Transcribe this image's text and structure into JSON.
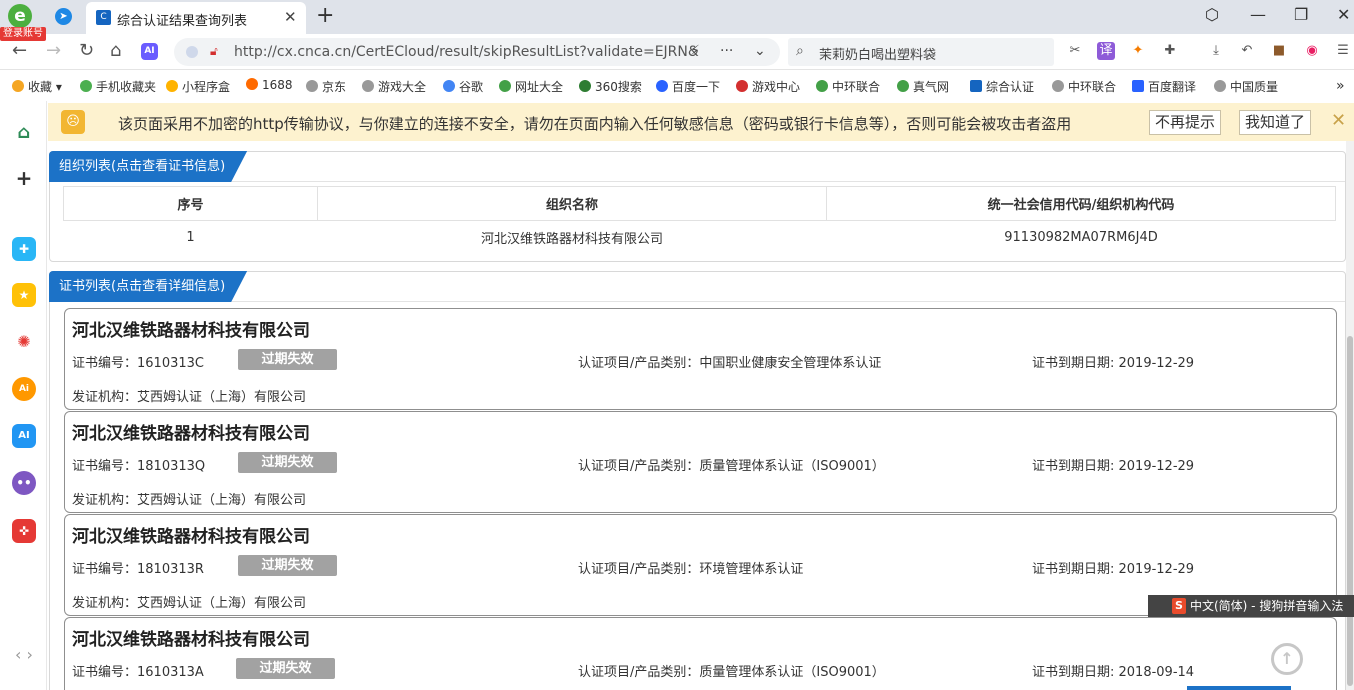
{
  "browser": {
    "login_badge": "登录账号",
    "tab_title": "综合认证结果查询列表",
    "url": "http://cx.cnca.cn/CertECloud/result/skipResultList?validate=EJRN&",
    "url_more": "···",
    "search_text": "茉莉奶白喝出塑料袋",
    "ai_label": "AI",
    "translate_label": "译"
  },
  "bookmarks": [
    {
      "label": "收藏",
      "color": "#f5a623"
    },
    {
      "label": "手机收藏夹",
      "color": "#4caf50"
    },
    {
      "label": "小程序盒",
      "color": "#ffb300"
    },
    {
      "label": "1688",
      "color": "#ff6a00"
    },
    {
      "label": "京东",
      "color": "#999999"
    },
    {
      "label": "游戏大全",
      "color": "#999999"
    },
    {
      "label": "谷歌",
      "color": "#4285f4"
    },
    {
      "label": "网址大全",
      "color": "#43a047"
    },
    {
      "label": "360搜索",
      "color": "#2e7d32"
    },
    {
      "label": "百度一下",
      "color": "#2962ff"
    },
    {
      "label": "游戏中心",
      "color": "#d32f2f"
    },
    {
      "label": "中环联合",
      "color": "#43a047"
    },
    {
      "label": "真气网",
      "color": "#43a047"
    },
    {
      "label": "综合认证",
      "color": "#1565c0"
    },
    {
      "label": "中环联合",
      "color": "#999999"
    },
    {
      "label": "百度翻译",
      "color": "#2962ff"
    },
    {
      "label": "中国质量",
      "color": "#999999"
    }
  ],
  "warning": {
    "text": "该页面采用不加密的http传输协议，与你建立的连接不安全，请勿在页面内输入任何敏感信息（密码或银行卡信息等），否则可能会被攻击者盗用",
    "btn_no_remind": "不再提示",
    "btn_ok": "我知道了"
  },
  "org_panel": {
    "title": "组织列表(点击查看证书信息)",
    "headers": [
      "序号",
      "组织名称",
      "统一社会信用代码/组织机构代码"
    ],
    "rows": [
      {
        "index": "1",
        "name": "河北汉维铁路器材科技有限公司",
        "code": "91130982MA07RM6J4D"
      }
    ]
  },
  "cert_panel": {
    "title": "证书列表(点击查看详细信息)",
    "items": [
      {
        "company": "河北汉维铁路器材科技有限公司",
        "cert_no": "证书编号：1610313C",
        "status": "过期失效",
        "category": "认证项目/产品类别：中国职业健康安全管理体系认证",
        "expiry": "证书到期日期: 2019-12-29",
        "issuer": "发证机构：艾西姆认证（上海）有限公司"
      },
      {
        "company": "河北汉维铁路器材科技有限公司",
        "cert_no": "证书编号：1810313Q",
        "status": "过期失效",
        "category": "认证项目/产品类别：质量管理体系认证（ISO9001）",
        "expiry": "证书到期日期: 2019-12-29",
        "issuer": "发证机构：艾西姆认证（上海）有限公司"
      },
      {
        "company": "河北汉维铁路器材科技有限公司",
        "cert_no": "证书编号：1810313R",
        "status": "过期失效",
        "category": "认证项目/产品类别：环境管理体系认证",
        "expiry": "证书到期日期: 2019-12-29",
        "issuer": "发证机构：艾西姆认证（上海）有限公司"
      },
      {
        "company": "河北汉维铁路器材科技有限公司",
        "cert_no": "证书编号：1610313A",
        "status": "过期失效",
        "category": "认证项目/产品类别：质量管理体系认证（ISO9001）",
        "expiry": "证书到期日期: 2018-09-14",
        "issuer": ""
      }
    ]
  },
  "ime": {
    "label": "中文(简体) - 搜狗拼音输入法",
    "badge": "S"
  }
}
